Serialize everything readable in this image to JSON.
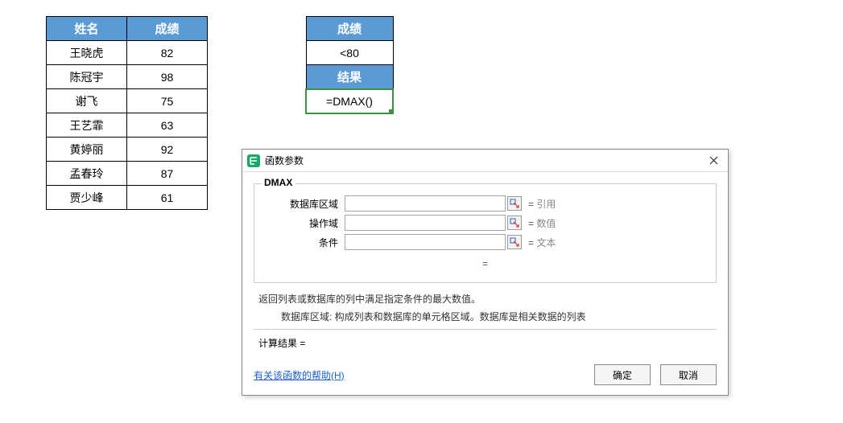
{
  "tables": {
    "main": {
      "headers": [
        "姓名",
        "成绩"
      ],
      "rows": [
        [
          "王晓虎",
          "82"
        ],
        [
          "陈冠宇",
          "98"
        ],
        [
          "谢飞",
          "75"
        ],
        [
          "王艺霏",
          "63"
        ],
        [
          "黄婷丽",
          "92"
        ],
        [
          "孟春玲",
          "87"
        ],
        [
          "贾少峰",
          "61"
        ]
      ]
    },
    "side": {
      "header1": "成绩",
      "criteria": "<80",
      "header2": "结果",
      "formula": "=DMAX()"
    }
  },
  "dialog": {
    "title": "函数参数",
    "func_name": "DMAX",
    "params": [
      {
        "label": "数据库区域",
        "hint": "引用"
      },
      {
        "label": "操作域",
        "hint": "数值"
      },
      {
        "label": "条件",
        "hint": "文本"
      }
    ],
    "equals_line": "=",
    "description": "返回列表或数据库的列中满足指定条件的最大数值。",
    "description_sub": "数据库区域:  构成列表和数据库的单元格区域。数据库是相关数据的列表",
    "result_label": "计算结果 =",
    "help_link": "有关该函数的帮助(H)",
    "ok": "确定",
    "cancel": "取消"
  }
}
